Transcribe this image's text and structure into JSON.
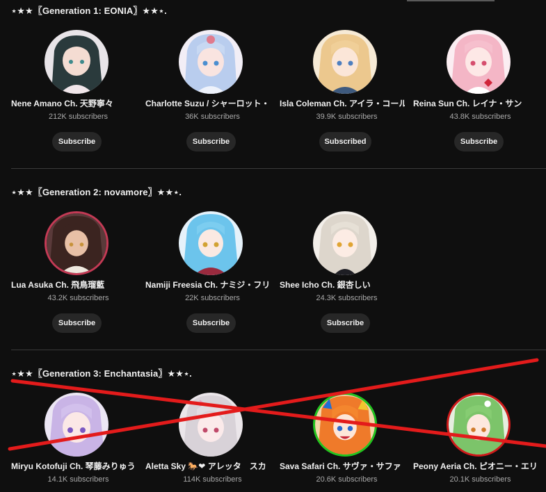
{
  "sections": [
    {
      "title": "⋆★★〖Generation 1: EONIA〗★★⋆.",
      "channels": [
        {
          "name": "Nene Amano Ch. 天野寧々",
          "subscribers": "212K subscribers",
          "button": "Subscribe"
        },
        {
          "name": "Charlotte Suzu / シャーロット・",
          "subscribers": "36K subscribers",
          "button": "Subscribe"
        },
        {
          "name": "Isla Coleman Ch. アイラ・コール",
          "subscribers": "39.9K subscribers",
          "button": "Subscribed"
        },
        {
          "name": "Reina Sun Ch. レイナ・サン",
          "subscribers": "43.8K subscribers",
          "button": "Subscribe"
        }
      ]
    },
    {
      "title": "⋆★★〖Generation 2: novamore〗★★⋆.",
      "channels": [
        {
          "name": "Lua Asuka Ch. 飛鳥瑠藍",
          "subscribers": "43.2K subscribers",
          "button": "Subscribe"
        },
        {
          "name": "Namiji Freesia Ch. ナミジ・フリ",
          "subscribers": "22K subscribers",
          "button": "Subscribe"
        },
        {
          "name": "Shee Icho Ch. 銀杏しい",
          "subscribers": "24.3K subscribers",
          "button": "Subscribe"
        }
      ]
    },
    {
      "title": "⋆★★〖Generation 3: Enchantasia〗★★⋆.",
      "channels": [
        {
          "name": "Miryu Kotofuji Ch. 琴藤みりゅう",
          "subscribers": "14.1K subscribers"
        },
        {
          "name": "Aletta Sky 🐎❤ アレッタ　スカ",
          "subscribers": "114K subscribers"
        },
        {
          "name": "Sava Safari Ch. サヴァ・サファ",
          "subscribers": "20.6K subscribers"
        },
        {
          "name": "Peony Aeria Ch. ピオニー・エリ",
          "subscribers": "20.1K subscribers"
        }
      ]
    }
  ],
  "colors": {
    "background": "#0f0f0f",
    "button": "#272727",
    "strike": "#e31b1b",
    "avatar_ring_lua": "#c43a55",
    "avatar_ring_sava": "#22c51f",
    "avatar_ring_peony": "#d01a1a"
  }
}
